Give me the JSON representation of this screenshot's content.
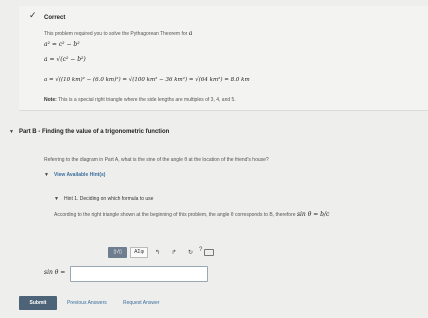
{
  "correct_panel": {
    "status": "Correct",
    "intro": "This problem required you to solve the Pythagorean Theorem for",
    "intro_var": "a",
    "eq1": "a² = c² − b²",
    "eq2": "a = √(c² − b²)",
    "eq3": "a = √((10 km)² − (6.0 km)²) = √(100 km² − 36 km²) = √(64 km²) = 8.0 km",
    "note_label": "Note:",
    "note_text": "This is a special right triangle where the side lengths are multiples of 3, 4, and 5."
  },
  "part_b": {
    "title": "Part B - Finding the value of a trigonometric function",
    "question": "Referring to the diagram in Part A, what is the sine of the angle θ at the location of the friend's house?",
    "hints_link": "View Available Hint(s)",
    "hint_title": "Hint 1. Deciding on which formula to use",
    "hint_body": "According to the right triangle shown at the beginning of this problem, the angle θ corresponds to B, therefore",
    "hint_formula": "sin θ = b/c"
  },
  "toolbar": {
    "templates_label": "▯√▯",
    "symbols_label": "AΣφ",
    "undo": "↰",
    "redo": "↱",
    "reset": "↻",
    "help": "?"
  },
  "answer": {
    "label": "sin θ =",
    "value": "",
    "placeholder": ""
  },
  "actions": {
    "submit": "Submit",
    "previous": "Previous Answers",
    "request": "Request Answer"
  }
}
